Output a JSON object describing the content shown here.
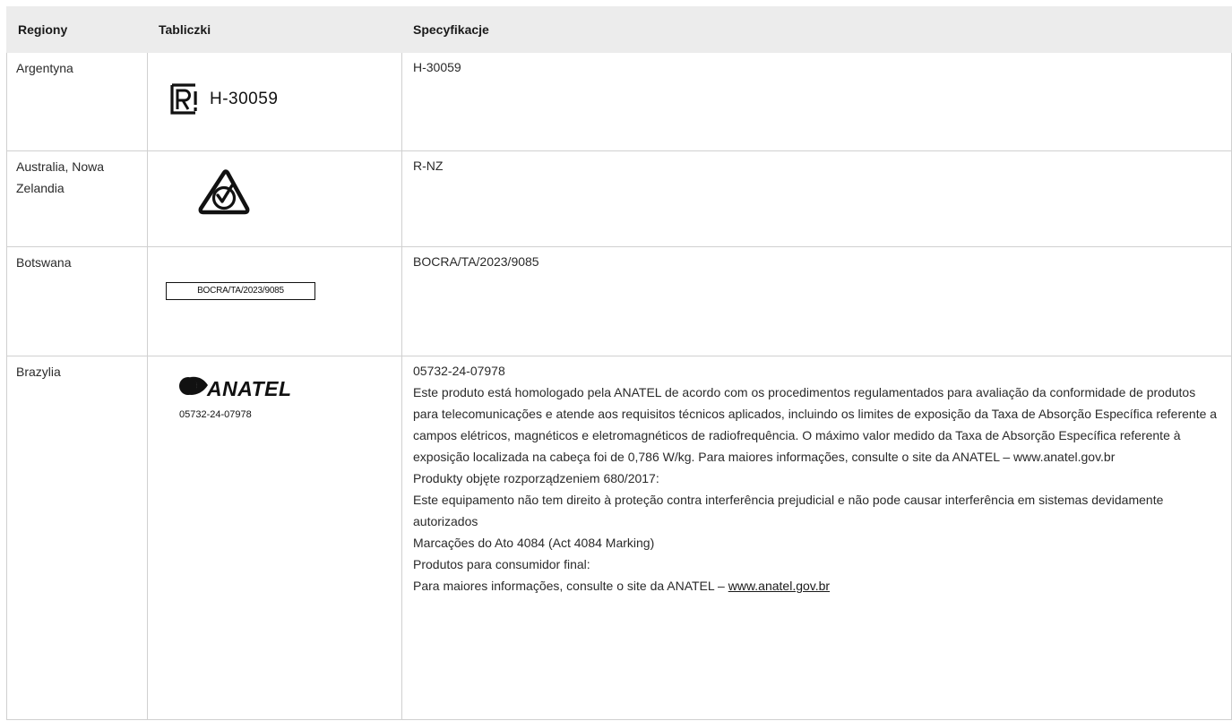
{
  "headers": {
    "regions": "Regiony",
    "plates": "Tabliczki",
    "specs": "Specyfikacje"
  },
  "rows": {
    "argentina": {
      "region": "Argentyna",
      "plate_text": "H-30059",
      "plate_icon": "r-certification-mark-icon",
      "spec": "H-30059"
    },
    "australia": {
      "region": "Australia, Nowa Zelandia",
      "plate_icon": "rcm-mark-icon",
      "spec": "R-NZ"
    },
    "botswana": {
      "region": "Botswana",
      "plate_text": "BOCRA/TA/2023/9085",
      "spec": "BOCRA/TA/2023/9085"
    },
    "brazil": {
      "region": "Brazylia",
      "plate_brand": "ANATEL",
      "plate_code": "05732-24-07978",
      "plate_icon": "anatel-logo-icon",
      "spec_lines": [
        "05732-24-07978",
        "Este produto está homologado pela ANATEL de acordo com os procedimentos regulamentados para avaliação da conformidade de produtos para telecomunicações e atende aos requisitos técnicos aplicados, incluindo os limites de exposição da Taxa de Absorção Específica referente a campos elétricos, magnéticos e eletromagnéticos de radiofrequência. O máximo valor medido da Taxa de Absorção Específica referente à exposição localizada na cabeça foi de 0,786 W/kg. Para maiores informações, consulte o site da ANATEL – www.anatel.gov.br",
        "Produkty objęte rozporządzeniem 680/2017:",
        "Este equipamento não tem direito à proteção contra interferência prejudicial e não pode causar interferência em sistemas devidamente autorizados",
        "Marcações do Ato 4084 (Act 4084 Marking)",
        "Produtos para consumidor final:"
      ],
      "spec_last_prefix": "Para maiores informações, consulte o site da ANATEL – ",
      "spec_link": "www.anatel.gov.br"
    }
  }
}
